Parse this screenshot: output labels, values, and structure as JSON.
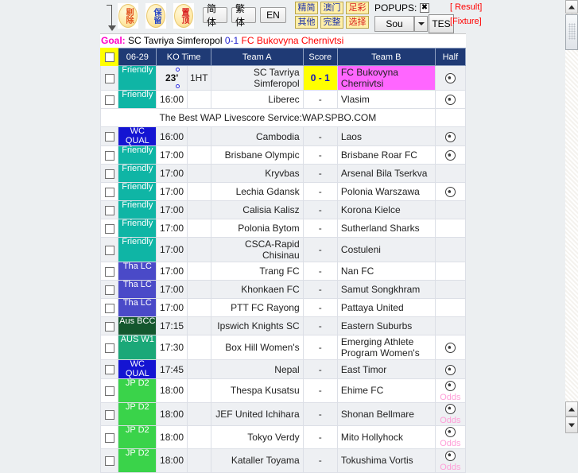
{
  "toolbar": {
    "round_buttons": [
      {
        "name": "remove",
        "label": "剔除"
      },
      {
        "name": "keep",
        "label": "保留"
      },
      {
        "name": "pin-top",
        "label": "置顶"
      }
    ],
    "lang_buttons": [
      {
        "name": "simplified",
        "label": "简体"
      },
      {
        "name": "traditional",
        "label": "繁体"
      },
      {
        "name": "english",
        "label": "EN"
      }
    ],
    "filter_buttons": [
      {
        "name": "concise",
        "label": "精简",
        "style": "blue"
      },
      {
        "name": "macau",
        "label": "澳门",
        "style": "blue"
      },
      {
        "name": "lottery",
        "label": "足彩",
        "style": "red"
      },
      {
        "name": "other",
        "label": "其他",
        "style": "blue"
      },
      {
        "name": "complete",
        "label": "完整",
        "style": "blue"
      },
      {
        "name": "select",
        "label": "选择",
        "style": "red"
      }
    ],
    "popups_label": "POPUPS:",
    "popups_close": "✖",
    "sound_select": "Sou",
    "test_button": "TES",
    "result_link": "[ Result]",
    "fixture_link": "[Fixture]"
  },
  "goal_bar": {
    "label": "Goal:",
    "home": "SC Tavriya Simferopol",
    "score": "0-1",
    "away": "FC Bukovyna Chernivtsi"
  },
  "table": {
    "headers": {
      "checkbox": "",
      "date": "06-29",
      "ko_time": "KO Time",
      "team_a": "Team A",
      "score": "Score",
      "team_b": "Team B",
      "half": "Half"
    },
    "promo_text": "The Best WAP Livescore Service:WAP.SPBO.COM",
    "odds_label": "Odds",
    "rows": [
      {
        "league": "Friendly",
        "league_style": "bg-friendly",
        "time": "23'",
        "live": true,
        "ht": "1HT",
        "team_a": "SC Tavriya Simferopol",
        "score": "0 - 1",
        "score_live": true,
        "team_b": "FC Bukovyna Chernivtsi",
        "team_b_live": true,
        "half": "ball",
        "odds": false,
        "shade": "alt"
      },
      {
        "league": "Friendly",
        "league_style": "bg-friendly",
        "time": "16:00",
        "live": false,
        "ht": "",
        "team_a": "Liberec",
        "score": "-",
        "score_live": false,
        "team_b": "Vlasim",
        "team_b_live": false,
        "half": "ball",
        "odds": false,
        "shade": "white"
      },
      {
        "league": "WC QUAL",
        "league_style": "bg-wcq",
        "time": "16:00",
        "live": false,
        "ht": "",
        "team_a": "Cambodia",
        "score": "-",
        "score_live": false,
        "team_b": "Laos",
        "team_b_live": false,
        "half": "ball",
        "odds": false,
        "shade": "alt"
      },
      {
        "league": "Friendly",
        "league_style": "bg-friendly",
        "time": "17:00",
        "live": false,
        "ht": "",
        "team_a": "Brisbane Olympic",
        "score": "-",
        "score_live": false,
        "team_b": "Brisbane Roar FC",
        "team_b_live": false,
        "half": "ball",
        "odds": false,
        "shade": "white"
      },
      {
        "league": "Friendly",
        "league_style": "bg-friendly",
        "time": "17:00",
        "live": false,
        "ht": "",
        "team_a": "Kryvbas",
        "score": "-",
        "score_live": false,
        "team_b": "Arsenal Bila Tserkva",
        "team_b_live": false,
        "half": "",
        "odds": false,
        "shade": "alt"
      },
      {
        "league": "Friendly",
        "league_style": "bg-friendly",
        "time": "17:00",
        "live": false,
        "ht": "",
        "team_a": "Lechia Gdansk",
        "score": "-",
        "score_live": false,
        "team_b": "Polonia Warszawa",
        "team_b_live": false,
        "half": "ball",
        "odds": false,
        "shade": "white"
      },
      {
        "league": "Friendly",
        "league_style": "bg-friendly",
        "time": "17:00",
        "live": false,
        "ht": "",
        "team_a": "Calisia Kalisz",
        "score": "-",
        "score_live": false,
        "team_b": "Korona Kielce",
        "team_b_live": false,
        "half": "",
        "odds": false,
        "shade": "alt"
      },
      {
        "league": "Friendly",
        "league_style": "bg-friendly",
        "time": "17:00",
        "live": false,
        "ht": "",
        "team_a": "Polonia Bytom",
        "score": "-",
        "score_live": false,
        "team_b": "Sutherland Sharks",
        "team_b_live": false,
        "half": "",
        "odds": false,
        "shade": "white"
      },
      {
        "league": "Friendly",
        "league_style": "bg-friendly",
        "time": "17:00",
        "live": false,
        "ht": "",
        "team_a": "CSCA-Rapid Chisinau",
        "score": "-",
        "score_live": false,
        "team_b": "Costuleni",
        "team_b_live": false,
        "half": "",
        "odds": false,
        "shade": "alt"
      },
      {
        "league": "Tha LC",
        "league_style": "bg-thalc",
        "time": "17:00",
        "live": false,
        "ht": "",
        "team_a": "Trang FC",
        "score": "-",
        "score_live": false,
        "team_b": "Nan FC",
        "team_b_live": false,
        "half": "",
        "odds": false,
        "shade": "white"
      },
      {
        "league": "Tha LC",
        "league_style": "bg-thalc",
        "time": "17:00",
        "live": false,
        "ht": "",
        "team_a": "Khonkaen FC",
        "score": "-",
        "score_live": false,
        "team_b": "Samut Songkhram",
        "team_b_live": false,
        "half": "",
        "odds": false,
        "shade": "alt"
      },
      {
        "league": "Tha LC",
        "league_style": "bg-thalc",
        "time": "17:00",
        "live": false,
        "ht": "",
        "team_a": "PTT FC Rayong",
        "score": "-",
        "score_live": false,
        "team_b": "Pattaya United",
        "team_b_live": false,
        "half": "",
        "odds": false,
        "shade": "white"
      },
      {
        "league": "Aus BCC",
        "league_style": "bg-ausbcc",
        "time": "17:15",
        "live": false,
        "ht": "",
        "team_a": "Ipswich Knights SC",
        "score": "-",
        "score_live": false,
        "team_b": "Eastern Suburbs",
        "team_b_live": false,
        "half": "",
        "odds": false,
        "shade": "alt"
      },
      {
        "league": "AUS W1",
        "league_style": "bg-ausw1",
        "time": "17:30",
        "live": false,
        "ht": "",
        "team_a": "Box Hill Women's",
        "score": "-",
        "score_live": false,
        "team_b": "Emerging Athlete Program Women's",
        "team_b_live": false,
        "half": "ball",
        "odds": false,
        "shade": "white"
      },
      {
        "league": "WC QUAL",
        "league_style": "bg-wcq",
        "time": "17:45",
        "live": false,
        "ht": "",
        "team_a": "Nepal",
        "score": "-",
        "score_live": false,
        "team_b": "East Timor",
        "team_b_live": false,
        "half": "ball",
        "odds": false,
        "shade": "alt"
      },
      {
        "league": "JP D2",
        "league_style": "bg-jpd2",
        "time": "18:00",
        "live": false,
        "ht": "",
        "team_a": "Thespa Kusatsu",
        "score": "-",
        "score_live": false,
        "team_b": "Ehime FC",
        "team_b_live": false,
        "half": "ball",
        "odds": true,
        "shade": "white"
      },
      {
        "league": "JP D2",
        "league_style": "bg-jpd2",
        "time": "18:00",
        "live": false,
        "ht": "",
        "team_a": "JEF United Ichihara",
        "score": "-",
        "score_live": false,
        "team_b": "Shonan Bellmare",
        "team_b_live": false,
        "half": "ball",
        "odds": true,
        "shade": "alt"
      },
      {
        "league": "JP D2",
        "league_style": "bg-jpd2",
        "time": "18:00",
        "live": false,
        "ht": "",
        "team_a": "Tokyo Verdy",
        "score": "-",
        "score_live": false,
        "team_b": "Mito Hollyhock",
        "team_b_live": false,
        "half": "ball",
        "odds": true,
        "shade": "white"
      },
      {
        "league": "JP D2",
        "league_style": "bg-jpd2",
        "time": "18:00",
        "live": false,
        "ht": "",
        "team_a": "Kataller Toyama",
        "score": "-",
        "score_live": false,
        "team_b": "Tokushima Vortis",
        "team_b_live": false,
        "half": "ball",
        "odds": true,
        "shade": "alt"
      }
    ]
  }
}
